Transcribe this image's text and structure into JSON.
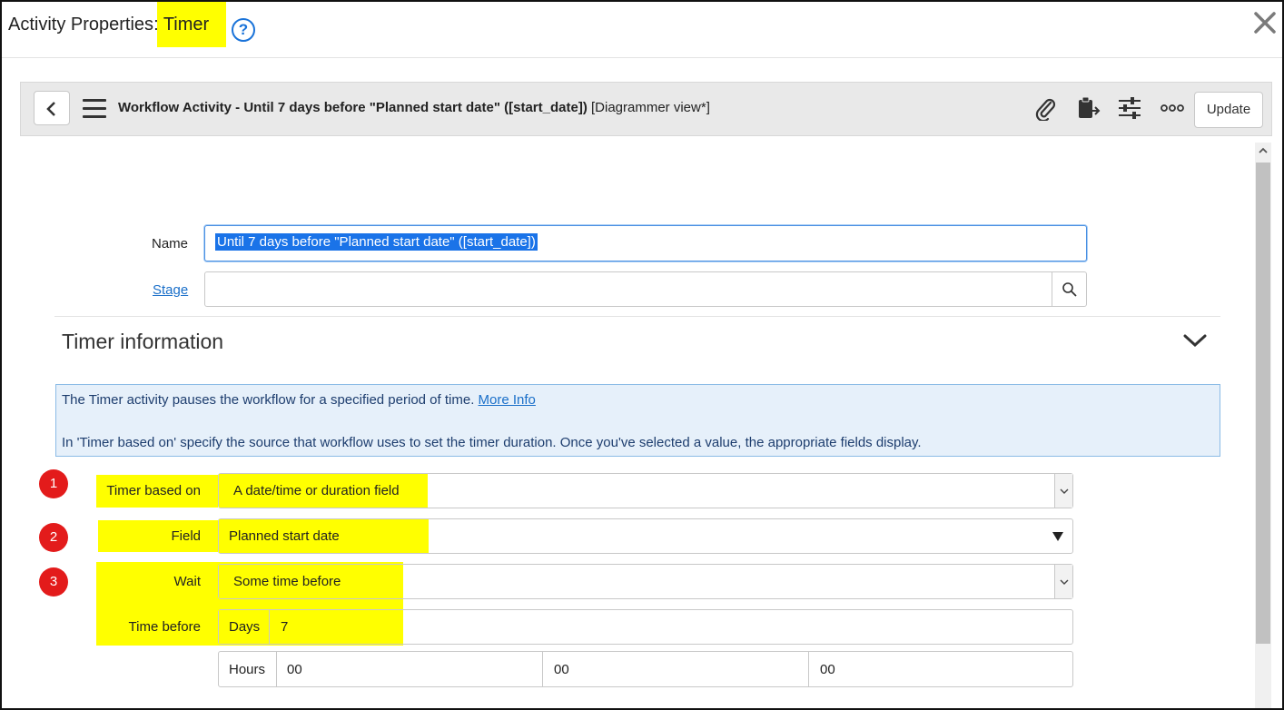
{
  "dialog": {
    "title_prefix": "Activity Properties",
    "title_highlight": ": Timer",
    "help_icon": "question-circle-icon",
    "close_icon": "close-x-icon"
  },
  "toolbar": {
    "back_icon": "chevron-left-icon",
    "menu_icon": "hamburger-menu-icon",
    "title_bold": "Workflow Activity - Until 7 days before \"Planned start date\" ([start_date])",
    "title_view": "[Diagrammer view*]",
    "icons": [
      "paperclip-icon",
      "clipboard-export-icon",
      "sliders-icon",
      "more-dots-icon"
    ],
    "update_label": "Update"
  },
  "form": {
    "name_label": "Name",
    "name_value": "Until 7 days before \"Planned start date\" ([start_date])",
    "stage_label": "Stage",
    "stage_value": ""
  },
  "section": {
    "title": "Timer information",
    "info_line1": "The Timer activity pauses the workflow for a specified period of time.",
    "info_link": "More Info",
    "info_line2": "In 'Timer based on' specify the source that workflow uses to set the timer duration. Once you've selected a value, the appropriate fields display."
  },
  "timer": {
    "badges": [
      "1",
      "2",
      "3"
    ],
    "based_on_label": "Timer based on",
    "based_on_value": "A date/time or duration field",
    "field_label": "Field",
    "field_value": "Planned start date",
    "wait_label": "Wait",
    "wait_value": "Some time before",
    "time_before_label": "Time before",
    "days_label": "Days",
    "days_value": "7",
    "hours_label": "Hours",
    "hours_value": "00",
    "minutes_value": "00",
    "seconds_value": "00"
  },
  "colors": {
    "highlight": "#ffff00",
    "badge": "#e31b1b",
    "link": "#1a6fc9",
    "info_bg": "#e6f0fa",
    "selection": "#1a73e8"
  }
}
